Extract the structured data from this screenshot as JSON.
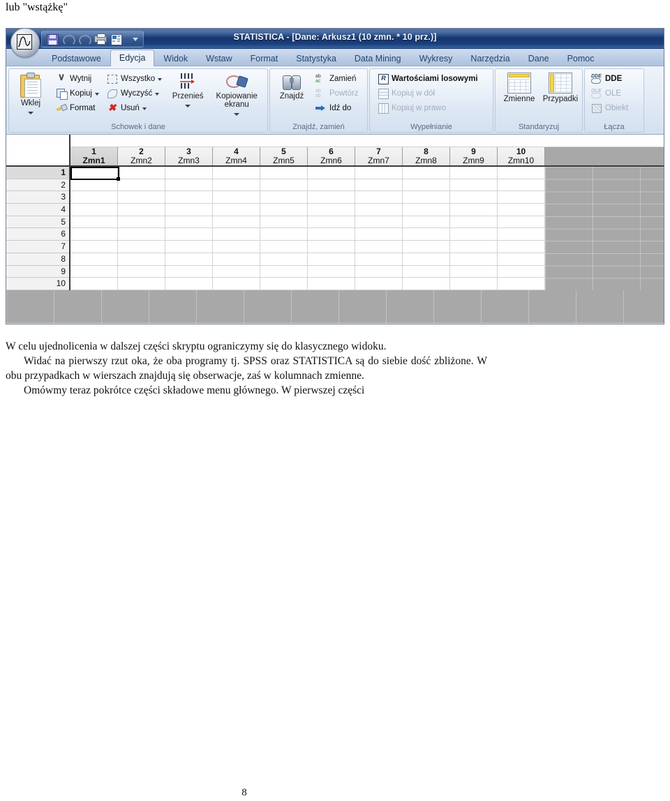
{
  "document": {
    "heading": "lub \"wstążkę\"",
    "paragraphs": [
      "W celu ujednolicenia w dalszej części skryptu ograniczymy się do klasycznego widoku.",
      "Widać na pierwszy rzut oka, że oba programy tj. SPSS oraz STATISTICA są do siebie dość zbliżone. W obu przypadkach w wierszach znajdują się obserwacje, zaś w kolumnach zmienne.",
      "Omówmy teraz pokrótce części składowe menu głównego. W pierwszej części"
    ],
    "page_number": "8"
  },
  "app": {
    "title": "STATISTICA - [Dane: Arkusz1 (10 zmn. * 10 prz.)]",
    "quick_access": [
      {
        "name": "save-icon",
        "label": "Zapisz",
        "disabled": false
      },
      {
        "name": "undo-icon",
        "label": "Cofnij",
        "disabled": true
      },
      {
        "name": "redo-icon",
        "label": "Ponów",
        "disabled": true
      },
      {
        "name": "print-icon",
        "label": "Drukuj",
        "disabled": false
      },
      {
        "name": "spreadsheet-icon",
        "label": "Arkusz",
        "disabled": false
      }
    ],
    "tabs": [
      {
        "label": "Podstawowe",
        "active": false
      },
      {
        "label": "Edycja",
        "active": true
      },
      {
        "label": "Widok",
        "active": false
      },
      {
        "label": "Wstaw",
        "active": false
      },
      {
        "label": "Format",
        "active": false
      },
      {
        "label": "Statystyka",
        "active": false
      },
      {
        "label": "Data Mining",
        "active": false
      },
      {
        "label": "Wykresy",
        "active": false
      },
      {
        "label": "Narzędzia",
        "active": false
      },
      {
        "label": "Dane",
        "active": false
      },
      {
        "label": "Pomoc",
        "active": false
      }
    ],
    "ribbon": {
      "groups": [
        {
          "label": "Schowek i dane",
          "big_buttons": [
            {
              "label": "Wklej",
              "has_caret": true
            }
          ],
          "columns": [
            [
              {
                "label": "Wytnij",
                "icon": "scissors-icon",
                "disabled": false,
                "caret": false
              },
              {
                "label": "Kopiuj",
                "icon": "copy-icon",
                "disabled": false,
                "caret": true
              },
              {
                "label": "Format",
                "icon": "format-painter-icon",
                "disabled": false,
                "caret": false
              }
            ],
            [
              {
                "label": "Wszystko",
                "icon": "select-all-icon",
                "disabled": false,
                "caret": true
              },
              {
                "label": "Wyczyść",
                "icon": "eraser-icon",
                "disabled": false,
                "caret": true
              },
              {
                "label": "Usuń",
                "icon": "delete-icon",
                "disabled": false,
                "caret": true
              }
            ]
          ],
          "extra_big": [
            {
              "label": "Przenieś",
              "icon": "move-rows-icon",
              "has_caret": true
            },
            {
              "label": "Kopiowanie ekranu",
              "icon": "screen-capture-icon",
              "has_caret": true
            }
          ]
        },
        {
          "label": "Znajdź, zamień",
          "big_buttons": [
            {
              "label": "Znajdź",
              "icon": "binoculars-icon",
              "has_caret": false
            }
          ],
          "columns": [
            [
              {
                "label": "Zamień",
                "icon": "replace-icon",
                "disabled": false,
                "caret": false
              },
              {
                "label": "Powtórz",
                "icon": "repeat-icon",
                "disabled": true,
                "caret": false
              },
              {
                "label": "Idź do",
                "icon": "goto-arrow-icon",
                "disabled": false,
                "caret": false
              }
            ]
          ]
        },
        {
          "label": "Wypełnianie",
          "columns": [
            [
              {
                "label": "Wartościami losowymi",
                "icon": "random-values-icon",
                "disabled": false,
                "caret": false
              },
              {
                "label": "Kopiuj w dół",
                "icon": "fill-down-icon",
                "disabled": true,
                "caret": false
              },
              {
                "label": "Kopiuj w prawo",
                "icon": "fill-right-icon",
                "disabled": true,
                "caret": false
              }
            ]
          ]
        },
        {
          "label": "Standaryzuj",
          "big_buttons": [
            {
              "label": "Zmienne",
              "icon": "standardize-variables-icon",
              "has_caret": false
            },
            {
              "label": "Przypadki",
              "icon": "standardize-cases-icon",
              "has_caret": false
            }
          ]
        },
        {
          "label": "Łącza",
          "columns": [
            [
              {
                "label": "DDE",
                "icon": "dde-icon",
                "disabled": false,
                "caret": false
              },
              {
                "label": "OLE",
                "icon": "ole-icon",
                "disabled": true,
                "caret": false
              },
              {
                "label": "Obiekt",
                "icon": "object-icon",
                "disabled": true,
                "caret": false
              }
            ]
          ]
        }
      ]
    },
    "sheet": {
      "columns": [
        {
          "num": "1",
          "name": "Zmn1",
          "selected": true
        },
        {
          "num": "2",
          "name": "Zmn2",
          "selected": false
        },
        {
          "num": "3",
          "name": "Zmn3",
          "selected": false
        },
        {
          "num": "4",
          "name": "Zmn4",
          "selected": false
        },
        {
          "num": "5",
          "name": "Zmn5",
          "selected": false
        },
        {
          "num": "6",
          "name": "Zmn6",
          "selected": false
        },
        {
          "num": "7",
          "name": "Zmn7",
          "selected": false
        },
        {
          "num": "8",
          "name": "Zmn8",
          "selected": false
        },
        {
          "num": "9",
          "name": "Zmn9",
          "selected": false
        },
        {
          "num": "10",
          "name": "Zmn10",
          "selected": false
        }
      ],
      "rows": [
        {
          "num": "1",
          "selected": true
        },
        {
          "num": "2",
          "selected": false
        },
        {
          "num": "3",
          "selected": false
        },
        {
          "num": "4",
          "selected": false
        },
        {
          "num": "5",
          "selected": false
        },
        {
          "num": "6",
          "selected": false
        },
        {
          "num": "7",
          "selected": false
        },
        {
          "num": "8",
          "selected": false
        },
        {
          "num": "9",
          "selected": false
        },
        {
          "num": "10",
          "selected": false
        }
      ],
      "cells": [],
      "selected_cell": {
        "row": "1",
        "column": "Zmn1"
      }
    },
    "colors": {
      "titlebar": "#1b3f7d",
      "ribbon": "#e2ebf6",
      "accent": "#2a6fc4",
      "grid_gray": "#a8a8a8"
    }
  }
}
